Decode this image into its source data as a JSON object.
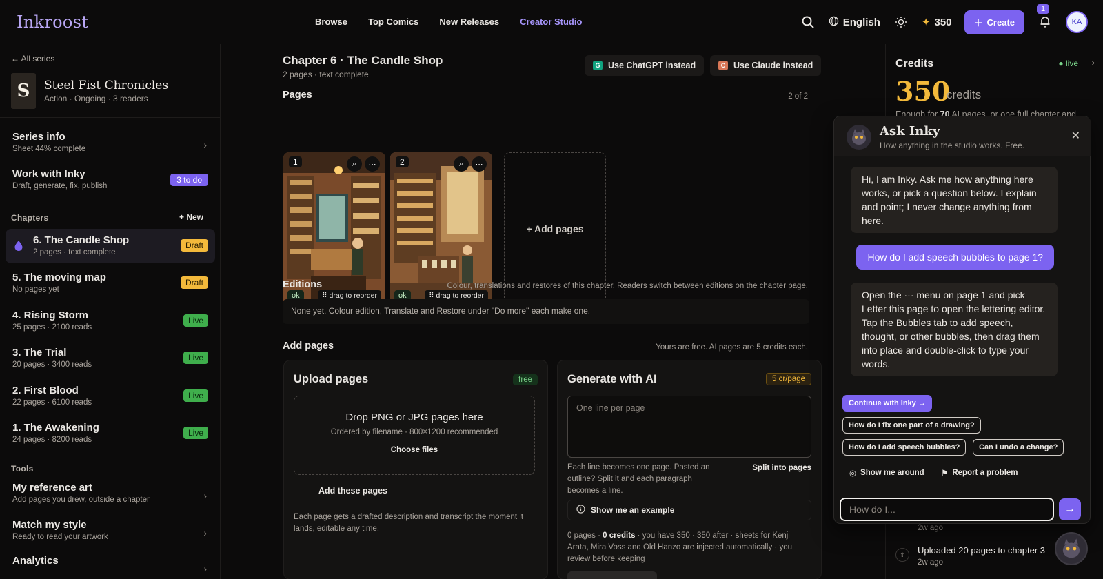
{
  "topbar": {
    "logo": "Inkroost",
    "nav": [
      "Browse",
      "Top Comics",
      "New Releases",
      "Creator Studio"
    ],
    "language": "English",
    "credits": "350",
    "create_label": "Create",
    "notifications": "1",
    "avatar_initials": "KA"
  },
  "sidebar": {
    "back": "← All series",
    "series_letter": "S",
    "series_title": "Steel Fist Chronicles",
    "series_meta": "Action · Ongoing · 3 readers",
    "series_info": {
      "title": "Series info",
      "sub": "Sheet 44% complete"
    },
    "inky": {
      "title": "Work with Inky",
      "sub": "Draft, generate, fix, publish",
      "badge": "3 to do"
    },
    "chapters_label": "Chapters",
    "new_label": "+ New",
    "chapters": [
      {
        "title": "6. The Candle Shop",
        "sub": "2 pages · text complete",
        "status": "Draft"
      },
      {
        "title": "5. The moving map",
        "sub": "No pages yet",
        "status": "Draft"
      },
      {
        "title": "4. Rising Storm",
        "sub": "25 pages · 2100 reads",
        "status": "Live"
      },
      {
        "title": "3. The Trial",
        "sub": "20 pages · 3400 reads",
        "status": "Live"
      },
      {
        "title": "2. First Blood",
        "sub": "22 pages · 6100 reads",
        "status": "Live"
      },
      {
        "title": "1. The Awakening",
        "sub": "24 pages · 8200 reads",
        "status": "Live"
      }
    ],
    "tools_label": "Tools",
    "tools": [
      {
        "title": "My reference art",
        "sub": "Add pages you drew, outside a chapter"
      },
      {
        "title": "Match my style",
        "sub": "Ready to read your artwork"
      },
      {
        "title": "Analytics",
        "sub": ""
      }
    ]
  },
  "main": {
    "chapter_title": "Chapter 6 · The Candle Shop",
    "chapter_sub": "2 pages · text complete",
    "use_chatgpt": "Use ChatGPT instead",
    "use_claude": "Use Claude instead",
    "pages_label": "Pages",
    "pages_count": "2 of 2",
    "pages": [
      {
        "num": "1",
        "status": "ok",
        "drag": "⠿ drag to reorder"
      },
      {
        "num": "2",
        "status": "ok",
        "drag": "⠿ drag to reorder"
      }
    ],
    "add_pages_tile": "+ Add pages",
    "editions_label": "Editions",
    "editions_note": "Colour, translations and restores of this chapter. Readers switch between editions on the chapter page.",
    "editions_empty": "None yet. Colour edition, Translate and Restore under \"Do more\" each make one.",
    "add_pages_label": "Add pages",
    "add_pages_note": "Yours are free. AI pages are 5 credits each.",
    "upload": {
      "title": "Upload pages",
      "pill": "free",
      "drop_title": "Drop PNG or JPG pages here",
      "drop_sub": "Ordered by filename · 800×1200 recommended",
      "choose": "Choose files",
      "add_these": "Add these pages",
      "note": "Each page gets a drafted description and transcript the moment it lands, editable any time."
    },
    "generate": {
      "title": "Generate with AI",
      "pill": "5 cr/page",
      "placeholder": "One line per page",
      "note": "Each line becomes one page. Pasted an outline? Split it and each paragraph becomes a line.",
      "split": "Split into pages",
      "example": "Show me an example",
      "cost_pre": "0 pages · ",
      "cost_bold": "0 credits",
      "cost_post": " · you have 350 · 350 after · sheets for Kenji Arata, Mira Voss and Old Hanzo are injected automatically · you review before keeping"
    }
  },
  "right": {
    "title": "Credits",
    "live": "live",
    "amount": "350",
    "unit": "credits",
    "enough_pre": "Enough for ",
    "enough_bold": "70",
    "enough_post": " AI pages, or one full chapter and",
    "activity": [
      {
        "title": "",
        "time": "2w ago"
      },
      {
        "title": "Uploaded 20 pages to chapter 3",
        "time": "2w ago"
      }
    ]
  },
  "chat": {
    "title": "Ask Inky",
    "subtitle": "How anything in the studio works. Free.",
    "messages": [
      {
        "role": "bot",
        "text": "Hi, I am Inky. Ask me how anything here works, or pick a question below. I explain and point; I never change anything from here."
      },
      {
        "role": "user",
        "text": "How do I add speech bubbles to page 1?"
      },
      {
        "role": "bot",
        "text": "Open the ··· menu on page 1 and pick Letter this page to open the lettering editor. Tap the Bubbles tab to add speech, thought, or other bubbles, then drag them into place and double-click to type your words."
      }
    ],
    "continue": "Continue with Inky →",
    "chips": [
      "How do I fix one part of a drawing?",
      "How do I add speech bubbles?",
      "Can I undo a change?"
    ],
    "show_around": "Show me around",
    "report": "Report a problem",
    "placeholder": "How do I..."
  },
  "colors": {
    "accent": "#7c63f0",
    "gold": "#f3b93b",
    "live": "#3fae4c"
  }
}
